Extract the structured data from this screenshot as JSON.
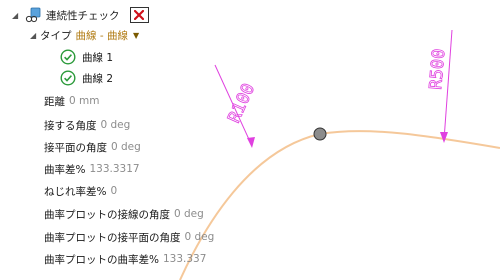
{
  "tree": {
    "root_label": "連続性チェック",
    "type_label": "タイプ",
    "type_value": "曲線 - 曲線",
    "curves": [
      "曲線 1",
      "曲線 2"
    ]
  },
  "props": [
    {
      "label": "距離",
      "value": "0 mm"
    },
    {
      "label": "接する角度",
      "value": "0 deg"
    },
    {
      "label": "接平面の角度",
      "value": "0 deg"
    },
    {
      "label": "曲率差%",
      "value": "133.3317"
    },
    {
      "label": "ねじれ率差%",
      "value": "0"
    },
    {
      "label": "曲率プロットの接線の角度",
      "value": "0 deg"
    },
    {
      "label": "曲率プロットの接平面の角度",
      "value": "0 deg"
    },
    {
      "label": "曲率プロットの曲率差%",
      "value": "133.337"
    }
  ],
  "viewport": {
    "label_left": "R100",
    "label_right": "R500",
    "curve_color": "#f5c89a",
    "annotation_color": "#e040e0"
  }
}
